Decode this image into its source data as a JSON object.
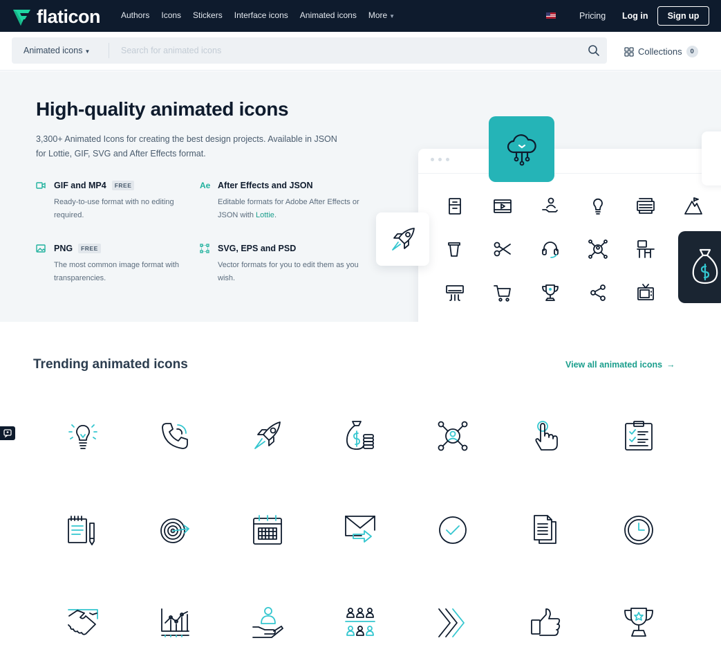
{
  "header": {
    "logo_text": "flaticon",
    "nav": [
      "Authors",
      "Icons",
      "Stickers",
      "Interface icons",
      "Animated icons",
      "More"
    ],
    "pricing": "Pricing",
    "login": "Log in",
    "signup": "Sign up"
  },
  "search": {
    "type_label": "Animated icons",
    "placeholder": "Search for animated icons",
    "value": "",
    "collections_label": "Collections",
    "collections_count": "0"
  },
  "hero": {
    "title": "High-quality animated icons",
    "description": "3,300+ Animated Icons for creating the best design projects. Available in JSON for Lottie, GIF, SVG and After Effects format.",
    "features": [
      {
        "icon": "video-icon",
        "title": "GIF and MP4",
        "badge": "FREE",
        "desc": "Ready-to-use format with no editing required.",
        "link": ""
      },
      {
        "icon": "ae-icon",
        "title": "After Effects and JSON",
        "badge": "",
        "desc": "Editable formats for Adobe After Effects or JSON with ",
        "link": "Lottie"
      },
      {
        "icon": "image-icon",
        "title": "PNG",
        "badge": "FREE",
        "desc": "The most common image format with transparencies.",
        "link": ""
      },
      {
        "icon": "vector-icon",
        "title": "SVG, EPS and PSD",
        "badge": "",
        "desc": "Vector formats for you to edit them as you wish.",
        "link": ""
      }
    ],
    "ae_glyph": "Ae"
  },
  "trending": {
    "title": "Trending animated icons",
    "view_all": "View all animated icons",
    "icons": [
      "lightbulb-icon",
      "phone-call-icon",
      "rocket-icon",
      "money-bag-icon",
      "network-user-icon",
      "touch-hand-icon",
      "clipboard-icon",
      "notepad-pencil-icon",
      "target-icon",
      "calendar-icon",
      "email-send-icon",
      "check-circle-icon",
      "documents-icon",
      "clock-icon",
      "handshake-icon",
      "growth-chart-icon",
      "care-user-icon",
      "team-icon",
      "chevrons-right-icon",
      "thumbs-up-icon",
      "trophy-icon"
    ]
  },
  "colors": {
    "navy": "#0e1b2d",
    "accent": "#34c6cf",
    "link_green": "#1a9e8c",
    "hero_bg": "#f3f6f8"
  }
}
